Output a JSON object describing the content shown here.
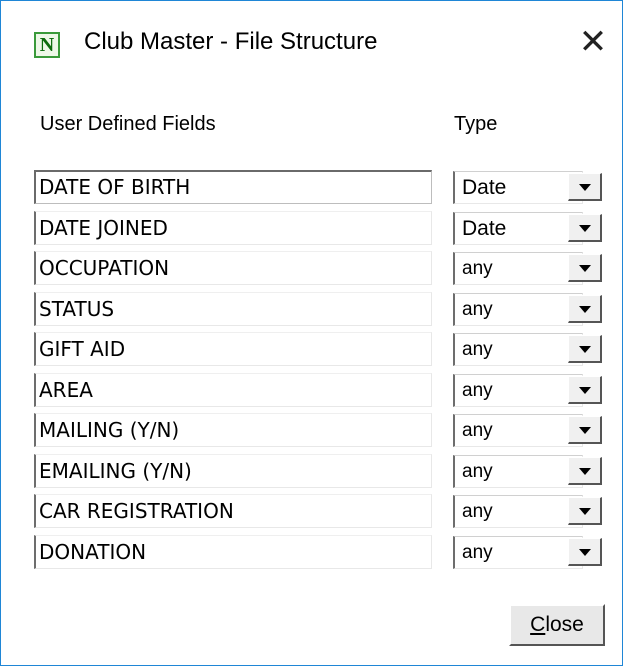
{
  "window": {
    "title": "Club Master - File Structure",
    "app_icon_letter": "N",
    "close_glyph": "✕"
  },
  "headers": {
    "fields": "User Defined Fields",
    "type": "Type"
  },
  "rows": [
    {
      "field": "DATE OF BIRTH",
      "type": "Date"
    },
    {
      "field": "DATE JOINED",
      "type": "Date"
    },
    {
      "field": "OCCUPATION",
      "type": "any"
    },
    {
      "field": "STATUS",
      "type": "any"
    },
    {
      "field": "GIFT AID",
      "type": "any"
    },
    {
      "field": "AREA",
      "type": "any"
    },
    {
      "field": "MAILING (Y/N)",
      "type": "any"
    },
    {
      "field": "EMAILING (Y/N)",
      "type": "any"
    },
    {
      "field": "CAR REGISTRATION",
      "type": "any"
    },
    {
      "field": "DONATION",
      "type": "any"
    }
  ],
  "buttons": {
    "close_mnemonic": "C",
    "close_rest": "lose"
  },
  "colors": {
    "window_border": "#1f86d6",
    "icon_green": "#0d6b0d"
  }
}
